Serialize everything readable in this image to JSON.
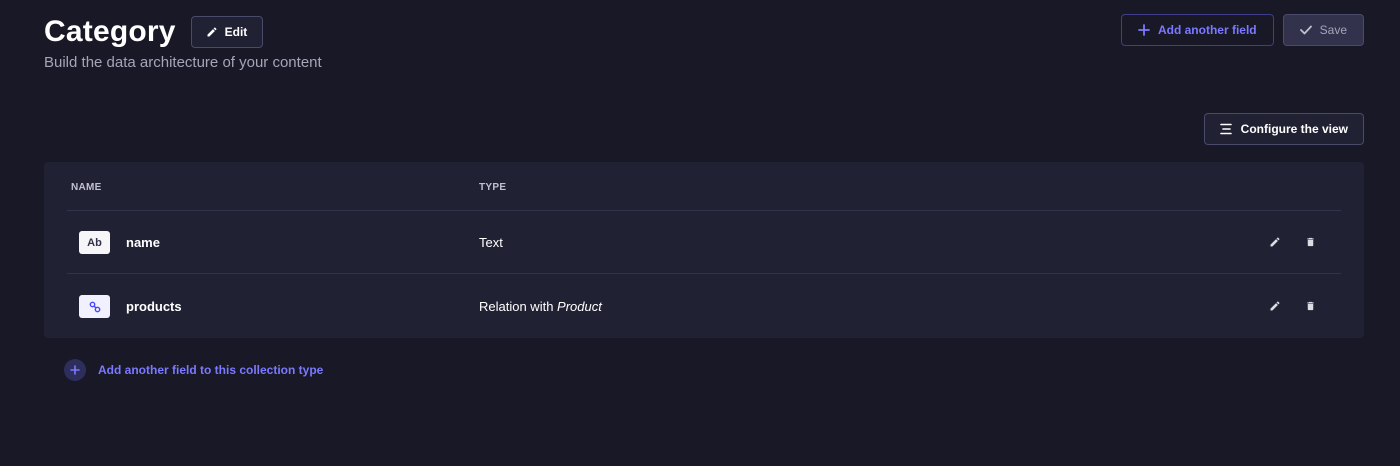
{
  "header": {
    "title": "Category",
    "edit_label": "Edit",
    "subtitle": "Build the data architecture of your content"
  },
  "actions": {
    "add_field_label": "Add another field",
    "save_label": "Save",
    "configure_label": "Configure the view"
  },
  "table": {
    "columns": [
      "NAME",
      "TYPE"
    ],
    "rows": [
      {
        "icon_text": "Ab",
        "icon": "text-icon",
        "name": "name",
        "type": "Text",
        "type_suffix": ""
      },
      {
        "icon_text": "",
        "icon": "relation-icon",
        "name": "products",
        "type": "Relation with ",
        "type_suffix": "Product"
      }
    ]
  },
  "footer": {
    "add_field_collection_label": "Add another field to this collection type"
  },
  "colors": {
    "background": "#181826",
    "card": "#212134",
    "accent": "#7b79ff",
    "border": "#4a4a6a"
  }
}
